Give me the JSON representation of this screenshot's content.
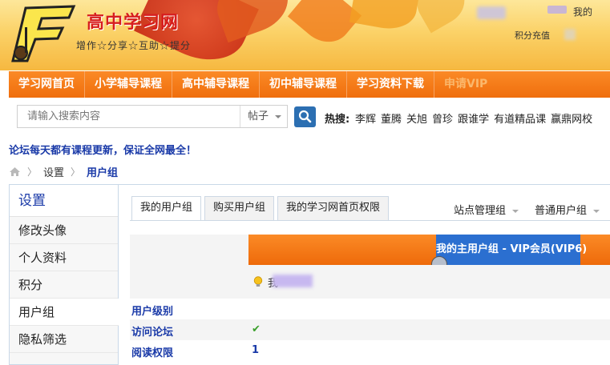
{
  "header": {
    "site_title": "高中学习网",
    "slogan": "增作☆分享☆互助☆提分",
    "user_mine": "我的",
    "user_points": "积分充值"
  },
  "nav": {
    "items": [
      {
        "label": "学习网首页"
      },
      {
        "label": "小学辅导课程"
      },
      {
        "label": "高中辅导课程"
      },
      {
        "label": "初中辅导课程"
      },
      {
        "label": "学习资料下载"
      },
      {
        "label": "申请VIP"
      }
    ]
  },
  "search": {
    "placeholder": "请输入搜索内容",
    "type_value": "帖子",
    "hot_label": "热搜:",
    "hot_links": [
      "李辉",
      "董腾",
      "关旭",
      "曾珍",
      "跟谁学",
      "有道精品课",
      "赢鼎网校"
    ]
  },
  "announcement": "论坛每天都有课程更新，保证全网最全！",
  "breadcrumb": {
    "items": [
      "设置",
      "用户组"
    ]
  },
  "sidebar": {
    "title": "设置",
    "items": [
      {
        "label": "修改头像"
      },
      {
        "label": "个人资料"
      },
      {
        "label": "积分"
      },
      {
        "label": "用户组"
      },
      {
        "label": "隐私筛选"
      }
    ]
  },
  "tabs": [
    {
      "label": "我的用户组"
    },
    {
      "label": "购买用户组"
    },
    {
      "label": "我的学习网首页权限"
    }
  ],
  "dropdowns": {
    "site_admin": "站点管理组",
    "normal_user": "普通用户组"
  },
  "group_table": {
    "header": "我的主用户组 - VIP会员(VIP6)",
    "name_prefix": "我",
    "rows": [
      {
        "label": "用户级别",
        "value": ""
      },
      {
        "label": "访问论坛",
        "value": "✔"
      },
      {
        "label": "阅读权限",
        "value": "1"
      }
    ]
  },
  "colors": {
    "nav_orange": "#ef6e0d",
    "link_blue": "#1a3aa8",
    "title_red": "#d71e1e",
    "check_green": "#3aa02b"
  }
}
